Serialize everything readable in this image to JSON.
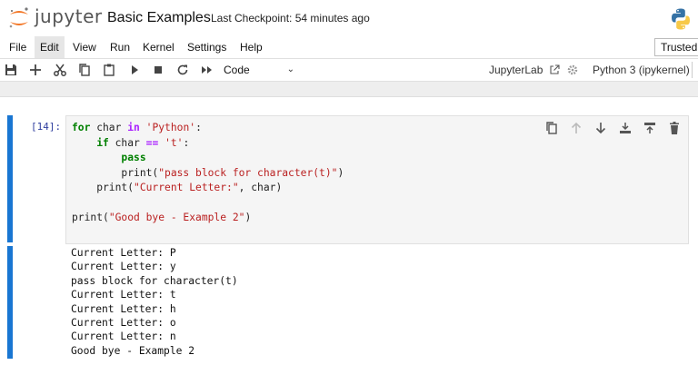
{
  "header": {
    "brand": "jupyter",
    "notebook_title": "Basic Examples",
    "checkpoint": "Last Checkpoint: 54 minutes ago",
    "logo_icon": "jupyter-logo-icon",
    "python_icon": "python-logo-icon"
  },
  "menu": {
    "items": [
      "File",
      "Edit",
      "View",
      "Run",
      "Kernel",
      "Settings",
      "Help"
    ],
    "active": "Edit",
    "trusted": "Trusted"
  },
  "toolbar": {
    "icons": [
      "save-icon",
      "add-cell-icon",
      "cut-icon",
      "copy-icon",
      "paste-icon",
      "run-icon",
      "stop-icon",
      "restart-icon",
      "run-all-icon"
    ],
    "cell_type": "Code",
    "jupyterlab_link": "JupyterLab",
    "kernel_name": "Python 3 (ipykernel)"
  },
  "cell": {
    "prompt": "[14]:",
    "code_lines": [
      "for char in 'Python':",
      "    if char == 't':",
      "        pass",
      "        print(\"pass block for character(t)\")",
      "    print(\"Current Letter:\", char)",
      "",
      "print(\"Good bye - Example 2\")"
    ],
    "tools": [
      "duplicate-icon",
      "move-up-icon",
      "move-down-icon",
      "insert-above-icon",
      "insert-below-icon",
      "delete-icon"
    ],
    "output_lines": [
      "Current Letter: P",
      "Current Letter: y",
      "pass block for character(t)",
      "Current Letter: t",
      "Current Letter: h",
      "Current Letter: o",
      "Current Letter: n",
      "Good bye - Example 2"
    ]
  },
  "colors": {
    "accent": "#1976d2",
    "jupyter_orange": "#f37726"
  }
}
